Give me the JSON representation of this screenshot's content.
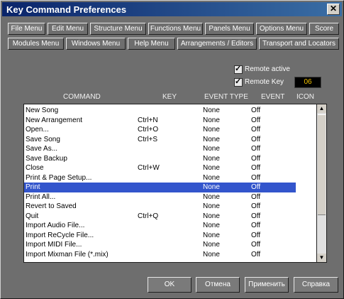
{
  "window": {
    "title": "Key Command Preferences",
    "close_glyph": "✕"
  },
  "tabs_row1": [
    "File Menu",
    "Edit Menu",
    "Structure Menu",
    "Functions Menu",
    "Panels Menu",
    "Options Menu",
    "Score"
  ],
  "tabs_row2": [
    "Modules Menu",
    "Windows Menu",
    "Help Menu",
    "Arrangements / Editors",
    "Transport and Locators"
  ],
  "active_tab": "File Menu",
  "remote": {
    "active_label": "Remote active",
    "active_checked": true,
    "key_label": "Remote Key",
    "key_checked": true,
    "key_value": "06"
  },
  "columns": {
    "command": "COMMAND",
    "key": "KEY",
    "event_type": "EVENT TYPE",
    "event": "EVENT",
    "icon": "ICON"
  },
  "rows": [
    {
      "command": "New Song",
      "key": "",
      "event_type": "None",
      "event": "Off"
    },
    {
      "command": "New Arrangement",
      "key": "Ctrl+N",
      "event_type": "None",
      "event": "Off"
    },
    {
      "command": "Open...",
      "key": "Ctrl+O",
      "event_type": "None",
      "event": "Off"
    },
    {
      "command": "Save Song",
      "key": "Ctrl+S",
      "event_type": "None",
      "event": "Off"
    },
    {
      "command": "Save As...",
      "key": "",
      "event_type": "None",
      "event": "Off"
    },
    {
      "command": "Save Backup",
      "key": "",
      "event_type": "None",
      "event": "Off"
    },
    {
      "command": "Close",
      "key": "Ctrl+W",
      "event_type": "None",
      "event": "Off"
    },
    {
      "command": "Print & Page Setup...",
      "key": "",
      "event_type": "None",
      "event": "Off"
    },
    {
      "command": "Print",
      "key": "",
      "event_type": "None",
      "event": "Off"
    },
    {
      "command": "Print All...",
      "key": "",
      "event_type": "None",
      "event": "Off"
    },
    {
      "command": "Revert to Saved",
      "key": "",
      "event_type": "None",
      "event": "Off"
    },
    {
      "command": "Quit",
      "key": "Ctrl+Q",
      "event_type": "None",
      "event": "Off"
    },
    {
      "command": "Import Audio File...",
      "key": "",
      "event_type": "None",
      "event": "Off"
    },
    {
      "command": "Import ReCycle File...",
      "key": "",
      "event_type": "None",
      "event": "Off"
    },
    {
      "command": "Import MIDI File...",
      "key": "",
      "event_type": "None",
      "event": "Off"
    },
    {
      "command": "Import Mixman File (*.mix)",
      "key": "",
      "event_type": "None",
      "event": "Off"
    }
  ],
  "selected_row_index": 8,
  "buttons": {
    "ok": "OK",
    "cancel": "Отмена",
    "apply": "Применить",
    "help": "Справка"
  }
}
